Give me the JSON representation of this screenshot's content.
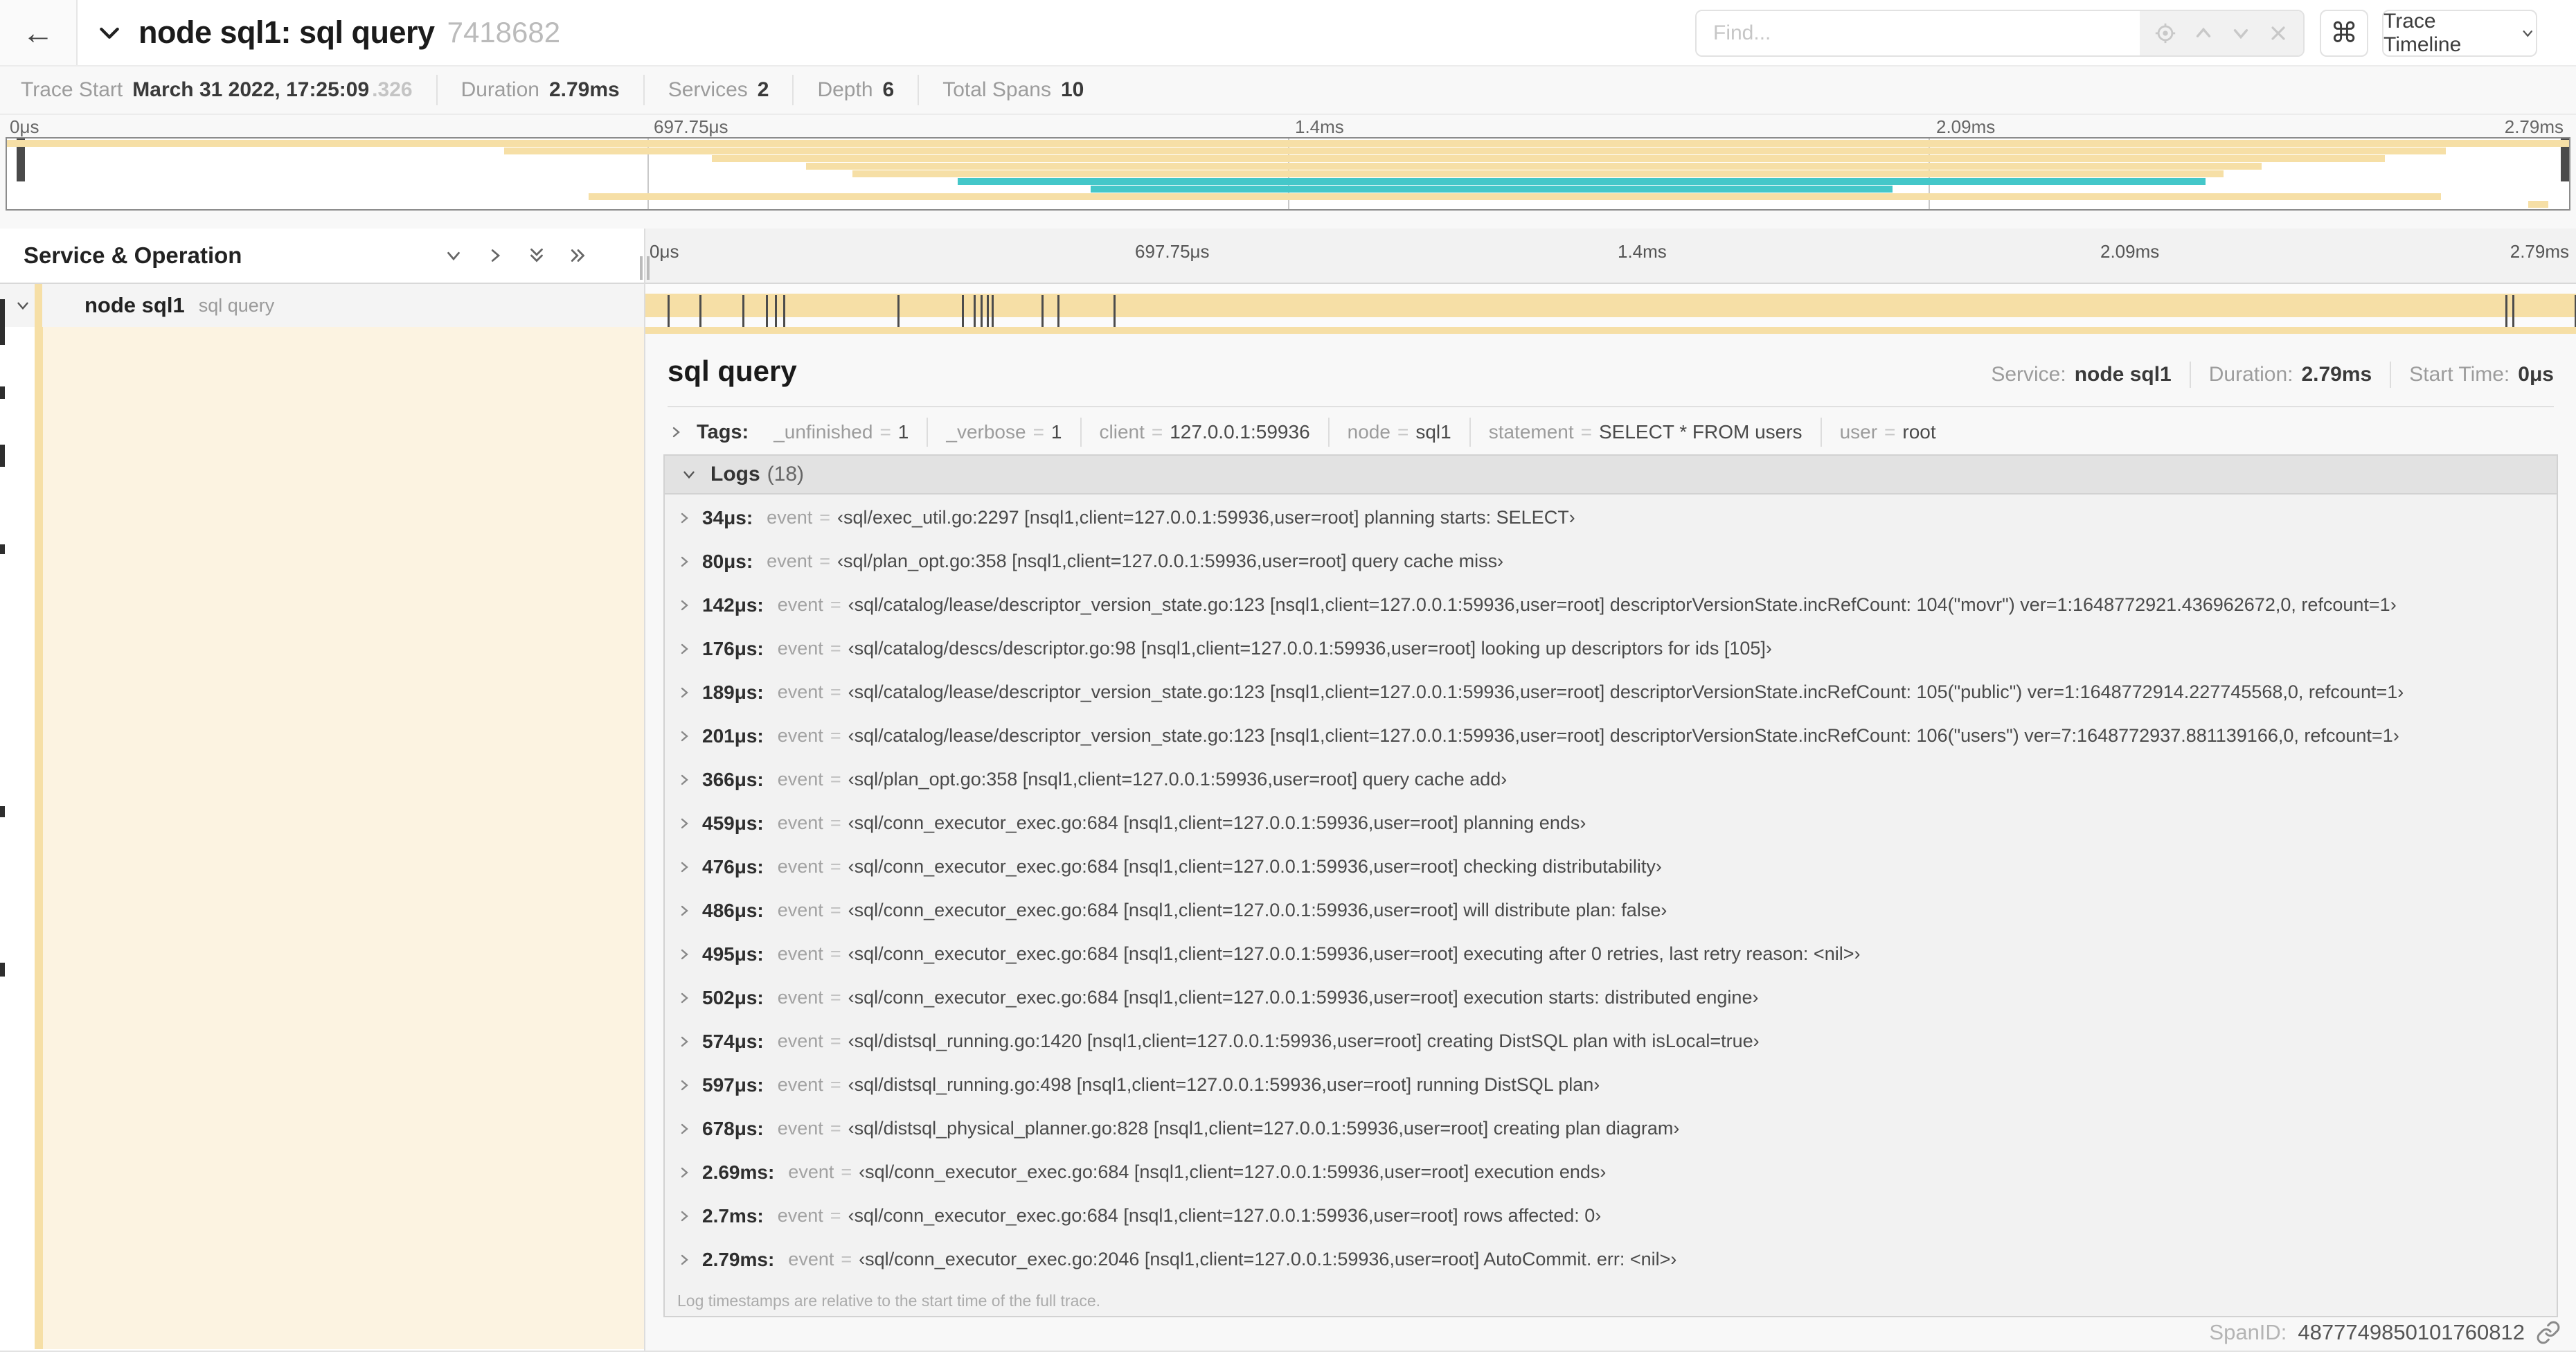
{
  "header": {
    "back_glyph": "←",
    "title": "node sql1: sql query",
    "trace_id": "7418682",
    "find_placeholder": "Find...",
    "shortcut_glyph": "⌘",
    "view_select": "Trace Timeline"
  },
  "summary": {
    "items": [
      {
        "label": "Trace Start",
        "value": "March 31 2022, 17:25:09",
        "suffix": ".326"
      },
      {
        "label": "Duration",
        "value": "2.79ms"
      },
      {
        "label": "Services",
        "value": "2"
      },
      {
        "label": "Depth",
        "value": "6"
      },
      {
        "label": "Total Spans",
        "value": "10"
      }
    ]
  },
  "timeline": {
    "ticks": [
      "0μs",
      "697.75μs",
      "1.4ms",
      "2.09ms",
      "2.79ms"
    ],
    "duration_us": 2790,
    "minimap_spans": [
      {
        "start": 0,
        "end": 100,
        "color": "tan"
      },
      {
        "start": 19.4,
        "end": 95.2,
        "color": "tan"
      },
      {
        "start": 27.5,
        "end": 92.8,
        "color": "tan"
      },
      {
        "start": 31.2,
        "end": 88.0,
        "color": "tan"
      },
      {
        "start": 33.0,
        "end": 86.5,
        "color": "tan"
      },
      {
        "start": 37.1,
        "end": 85.8,
        "color": "teal"
      },
      {
        "start": 42.3,
        "end": 73.6,
        "color": "teal"
      },
      {
        "start": 22.7,
        "end": 95.0,
        "color": "tan"
      },
      {
        "start": 98.4,
        "end": 99.2,
        "color": "tan"
      }
    ]
  },
  "left_panel": {
    "title": "Service & Operation"
  },
  "span_row": {
    "service": "node sql1",
    "operation": "sql query"
  },
  "detail": {
    "title": "sql query",
    "meta": [
      {
        "label": "Service:",
        "value": "node sql1"
      },
      {
        "label": "Duration:",
        "value": "2.79ms"
      },
      {
        "label": "Start Time:",
        "value": "0μs"
      }
    ],
    "tags_label": "Tags:",
    "tags": [
      {
        "key": "_unfinished",
        "value": "1"
      },
      {
        "key": "_verbose",
        "value": "1"
      },
      {
        "key": "client",
        "value": "127.0.0.1:59936"
      },
      {
        "key": "node",
        "value": "sql1"
      },
      {
        "key": "statement",
        "value": "SELECT * FROM users"
      },
      {
        "key": "user",
        "value": "root"
      }
    ],
    "logs": {
      "label": "Logs",
      "count": "(18)",
      "event_key": "event",
      "entries": [
        {
          "time": "34μs",
          "t_us": 34,
          "message": "‹sql/exec_util.go:2297 [nsql1,client=127.0.0.1:59936,user=root] planning starts: SELECT›"
        },
        {
          "time": "80μs",
          "t_us": 80,
          "message": "‹sql/plan_opt.go:358 [nsql1,client=127.0.0.1:59936,user=root] query cache miss›"
        },
        {
          "time": "142μs",
          "t_us": 142,
          "message": "‹sql/catalog/lease/descriptor_version_state.go:123 [nsql1,client=127.0.0.1:59936,user=root] descriptorVersionState.incRefCount: 104(\"movr\") ver=1:1648772921.436962672,0, refcount=1›"
        },
        {
          "time": "176μs",
          "t_us": 176,
          "message": "‹sql/catalog/descs/descriptor.go:98 [nsql1,client=127.0.0.1:59936,user=root] looking up descriptors for ids [105]›"
        },
        {
          "time": "189μs",
          "t_us": 189,
          "message": "‹sql/catalog/lease/descriptor_version_state.go:123 [nsql1,client=127.0.0.1:59936,user=root] descriptorVersionState.incRefCount: 105(\"public\") ver=1:1648772914.227745568,0, refcount=1›"
        },
        {
          "time": "201μs",
          "t_us": 201,
          "message": "‹sql/catalog/lease/descriptor_version_state.go:123 [nsql1,client=127.0.0.1:59936,user=root] descriptorVersionState.incRefCount: 106(\"users\") ver=7:1648772937.881139166,0, refcount=1›"
        },
        {
          "time": "366μs",
          "t_us": 366,
          "message": "‹sql/plan_opt.go:358 [nsql1,client=127.0.0.1:59936,user=root] query cache add›"
        },
        {
          "time": "459μs",
          "t_us": 459,
          "message": "‹sql/conn_executor_exec.go:684 [nsql1,client=127.0.0.1:59936,user=root] planning ends›"
        },
        {
          "time": "476μs",
          "t_us": 476,
          "message": "‹sql/conn_executor_exec.go:684 [nsql1,client=127.0.0.1:59936,user=root] checking distributability›"
        },
        {
          "time": "486μs",
          "t_us": 486,
          "message": "‹sql/conn_executor_exec.go:684 [nsql1,client=127.0.0.1:59936,user=root] will distribute plan: false›"
        },
        {
          "time": "495μs",
          "t_us": 495,
          "message": "‹sql/conn_executor_exec.go:684 [nsql1,client=127.0.0.1:59936,user=root] executing after 0 retries, last retry reason: <nil>›"
        },
        {
          "time": "502μs",
          "t_us": 502,
          "message": "‹sql/conn_executor_exec.go:684 [nsql1,client=127.0.0.1:59936,user=root] execution starts: distributed engine›"
        },
        {
          "time": "574μs",
          "t_us": 574,
          "message": "‹sql/distsql_running.go:1420 [nsql1,client=127.0.0.1:59936,user=root] creating DistSQL plan with isLocal=true›"
        },
        {
          "time": "597μs",
          "t_us": 597,
          "message": "‹sql/distsql_running.go:498 [nsql1,client=127.0.0.1:59936,user=root] running DistSQL plan›"
        },
        {
          "time": "678μs",
          "t_us": 678,
          "message": "‹sql/distsql_physical_planner.go:828 [nsql1,client=127.0.0.1:59936,user=root] creating plan diagram›"
        },
        {
          "time": "2.69ms",
          "t_us": 2690,
          "message": "‹sql/conn_executor_exec.go:684 [nsql1,client=127.0.0.1:59936,user=root] execution ends›"
        },
        {
          "time": "2.7ms",
          "t_us": 2700,
          "message": "‹sql/conn_executor_exec.go:684 [nsql1,client=127.0.0.1:59936,user=root] rows affected: 0›"
        },
        {
          "time": "2.79ms",
          "t_us": 2790,
          "message": "‹sql/conn_executor_exec.go:2046 [nsql1,client=127.0.0.1:59936,user=root] AutoCommit. err: <nil>›"
        }
      ],
      "footer": "Log timestamps are relative to the start time of the full trace."
    },
    "span_id_label": "SpanID:",
    "span_id": "4877749850101760812"
  },
  "colors": {
    "tan": "#f6dfa6",
    "teal": "#44c7c9",
    "cream": "#fcf3e1",
    "tick": "#4c4c4c"
  }
}
